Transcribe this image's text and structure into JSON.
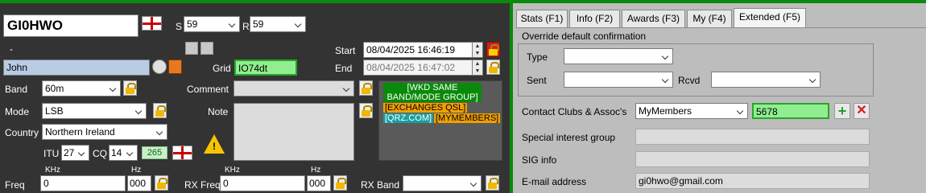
{
  "callsign": "GI0HWO",
  "rst": {
    "s_label": "S",
    "s_value": "59",
    "r_label": "R",
    "r_value": "59"
  },
  "dash": "-",
  "start": {
    "label": "Start",
    "value": "08/04/2025 16:46:19"
  },
  "end": {
    "label": "End",
    "value": "08/04/2025 16:47:02"
  },
  "name_value": "John",
  "grid": {
    "label": "Grid",
    "value": "IO74dt"
  },
  "band": {
    "label": "Band",
    "value": "60m"
  },
  "mode": {
    "label": "Mode",
    "value": "LSB"
  },
  "country": {
    "label": "Country",
    "value": "Northern Ireland"
  },
  "itu": {
    "label": "ITU",
    "value": "27"
  },
  "cq": {
    "label": "CQ",
    "value": "14"
  },
  "dxcc": "265",
  "comment": {
    "label": "Comment",
    "value": ""
  },
  "note": {
    "label": "Note"
  },
  "tags": {
    "wkd": "[WKD SAME BAND/MODE GROUP]",
    "exch": "[EXCHANGES QSL]",
    "qrz": "[QRZ.COM]",
    "members": "[MYMEMBERS]"
  },
  "freq": {
    "label": "Freq",
    "khz_label": "KHz",
    "hz_label": "Hz",
    "khz_value": "0",
    "hz_value": "000"
  },
  "rxfreq": {
    "label": "RX Freq",
    "khz_label": "KHz",
    "hz_label": "Hz",
    "khz_value": "0",
    "hz_value": "000"
  },
  "rxband": {
    "label": "RX Band",
    "value": ""
  },
  "tabs": [
    "Stats (F1)",
    "Info (F2)",
    "Awards (F3)",
    "My (F4)",
    "Extended (F5)"
  ],
  "override": {
    "title": "Override default confirmation",
    "type_label": "Type",
    "sent_label": "Sent",
    "rcvd_label": "Rcvd"
  },
  "clubs": {
    "label": "Contact Clubs & Assoc's",
    "select": "MyMembers",
    "value": "5678"
  },
  "sig_group": {
    "label": "Special interest group",
    "value": ""
  },
  "sig_info": {
    "label": "SIG info",
    "value": ""
  },
  "email": {
    "label": "E-mail address",
    "value": "gi0hwo@gmail.com"
  },
  "colors": {
    "panel_dark": "#333333",
    "panel_light": "#bdbdbd",
    "accent_green": "#0a8a0a",
    "highlight_green": "#90ee90"
  }
}
